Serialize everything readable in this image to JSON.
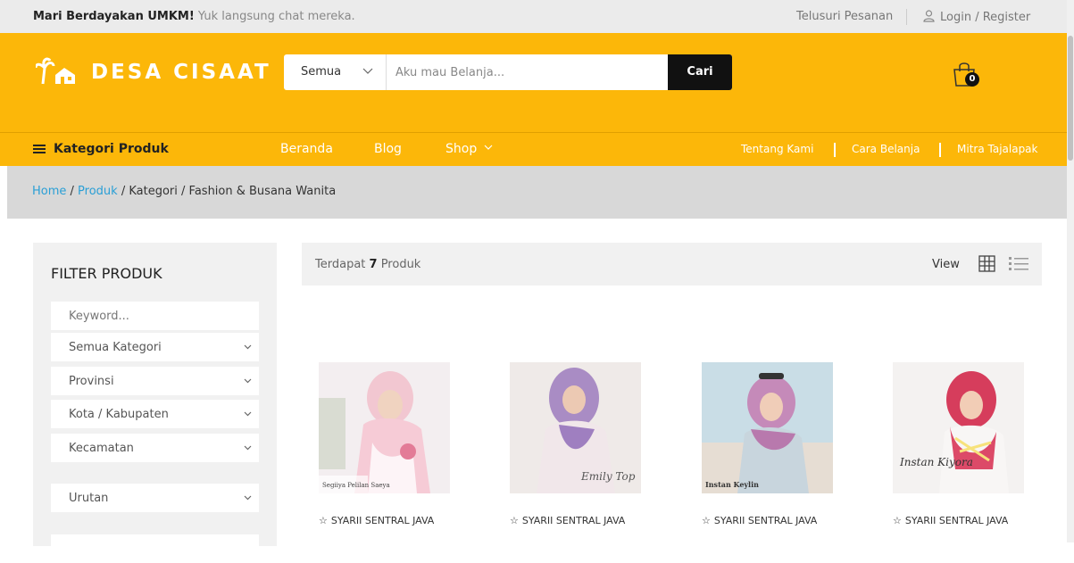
{
  "topbar": {
    "promo_bold": "Mari Berdayakan UMKM!",
    "promo_text": " Yuk langsung chat mereka.",
    "track_order": "Telusuri Pesanan",
    "login": "Login / Register"
  },
  "header": {
    "logo_text": "DESA CISAAT",
    "search": {
      "category": "Semua",
      "placeholder": "Aku mau Belanja...",
      "button": "Cari"
    },
    "cart_count": "0"
  },
  "nav": {
    "categories": "Kategori Produk",
    "links": [
      "Beranda",
      "Blog",
      "Shop"
    ],
    "right_links": [
      "Tentang Kami",
      "Cara Belanja",
      "Mitra Tajalapak"
    ]
  },
  "breadcrumb": {
    "home": "Home",
    "produk": "Produk",
    "kategori": "Kategori",
    "current": "Fashion & Busana Wanita",
    "separator": " / "
  },
  "sidebar": {
    "title": "FILTER PRODUK",
    "keyword_placeholder": "Keyword...",
    "selects": [
      "Semua Kategori",
      "Provinsi",
      "Kota / Kabupaten",
      "Kecamatan"
    ],
    "sort": "Urutan"
  },
  "results": {
    "prefix": "Terdapat ",
    "count": "7",
    "suffix": " Produk",
    "view_label": "View"
  },
  "products": [
    {
      "store": "SYARII SENTRAL JAVA",
      "caption": "Segiiya Pelilan Saeya"
    },
    {
      "store": "SYARII SENTRAL JAVA",
      "caption": "Emily Top"
    },
    {
      "store": "SYARII SENTRAL JAVA",
      "caption": "Instan Keylin"
    },
    {
      "store": "SYARII SENTRAL JAVA",
      "caption": "Instan Kiyora"
    }
  ],
  "colors": {
    "brand": "#fcb709",
    "link": "#2a9fd6"
  }
}
